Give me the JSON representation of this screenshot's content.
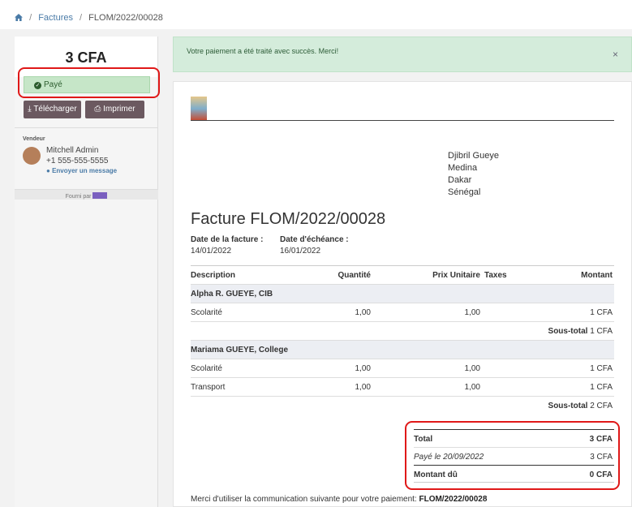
{
  "breadcrumb": {
    "items": [
      "Factures",
      "FLOM/2022/00028"
    ]
  },
  "sidebar": {
    "amount": "3 CFA",
    "status": "Payé",
    "download_label": "Télécharger",
    "print_label": "Imprimer",
    "vendor_title": "Vendeur",
    "vendor_name": "Mitchell Admin",
    "vendor_phone": "+1 555-555-5555",
    "vendor_message": "Envoyer un message",
    "powered_by": "Fourni par"
  },
  "alert": {
    "message": "Votre paiement a été traité avec succès. Merci!",
    "close": "×"
  },
  "document": {
    "address": [
      "Djibril Gueye",
      "Medina",
      "Dakar",
      "Sénégal"
    ],
    "title": "Facture FLOM/2022/00028",
    "invoice_date_label": "Date de la facture :",
    "invoice_date": "14/01/2022",
    "due_date_label": "Date d'échéance :",
    "due_date": "16/01/2022",
    "columns": {
      "description": "Description",
      "quantity": "Quantité",
      "unit_price": "Prix Unitaire",
      "taxes": "Taxes",
      "amount": "Montant"
    },
    "groups": [
      {
        "name": "Alpha R. GUEYE, CIB",
        "lines": [
          {
            "description": "Scolarité",
            "quantity": "1,00",
            "unit_price": "1,00",
            "amount": "1 CFA"
          }
        ],
        "subtotal_label": "Sous-total",
        "subtotal": "1 CFA"
      },
      {
        "name": "Mariama GUEYE, College",
        "lines": [
          {
            "description": "Scolarité",
            "quantity": "1,00",
            "unit_price": "1,00",
            "amount": "1 CFA"
          },
          {
            "description": "Transport",
            "quantity": "1,00",
            "unit_price": "1,00",
            "amount": "1 CFA"
          }
        ],
        "subtotal_label": "Sous-total",
        "subtotal": "2 CFA"
      }
    ],
    "totals": {
      "total_label": "Total",
      "total": "3 CFA",
      "paid_label": "Payé le 20/09/2022",
      "paid": "3 CFA",
      "due_label": "Montant dû",
      "due": "0 CFA"
    },
    "footnote_prefix": "Merci d'utiliser la communication suivante pour votre paiement:",
    "footnote_ref": "FLOM/2022/00028"
  }
}
